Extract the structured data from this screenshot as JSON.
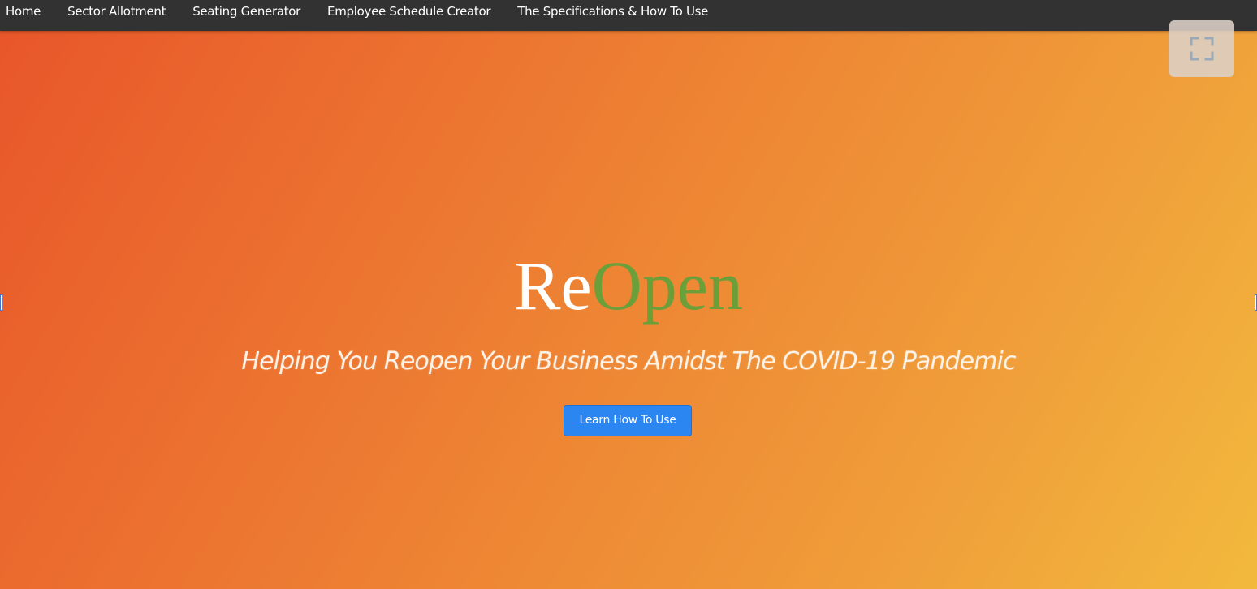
{
  "nav": {
    "items": [
      {
        "label": "Home"
      },
      {
        "label": "Sector Allotment"
      },
      {
        "label": "Seating Generator"
      },
      {
        "label": "Employee Schedule Creator"
      },
      {
        "label": "The Specifications & How To Use"
      }
    ]
  },
  "controls": {
    "fullscreen_icon": "fullscreen-icon"
  },
  "hero": {
    "title_part_1": "Re",
    "title_part_2": "Open",
    "subtitle": "Helping You Reopen Your Business Amidst The COVID-19 Pandemic",
    "cta_label": "Learn How To Use"
  },
  "colors": {
    "navbar": "#323232",
    "gradient_start": "#e8552a",
    "gradient_end": "#f2b93d",
    "title_accent": "#6a9f3a",
    "cta_button": "#2b86f2"
  }
}
